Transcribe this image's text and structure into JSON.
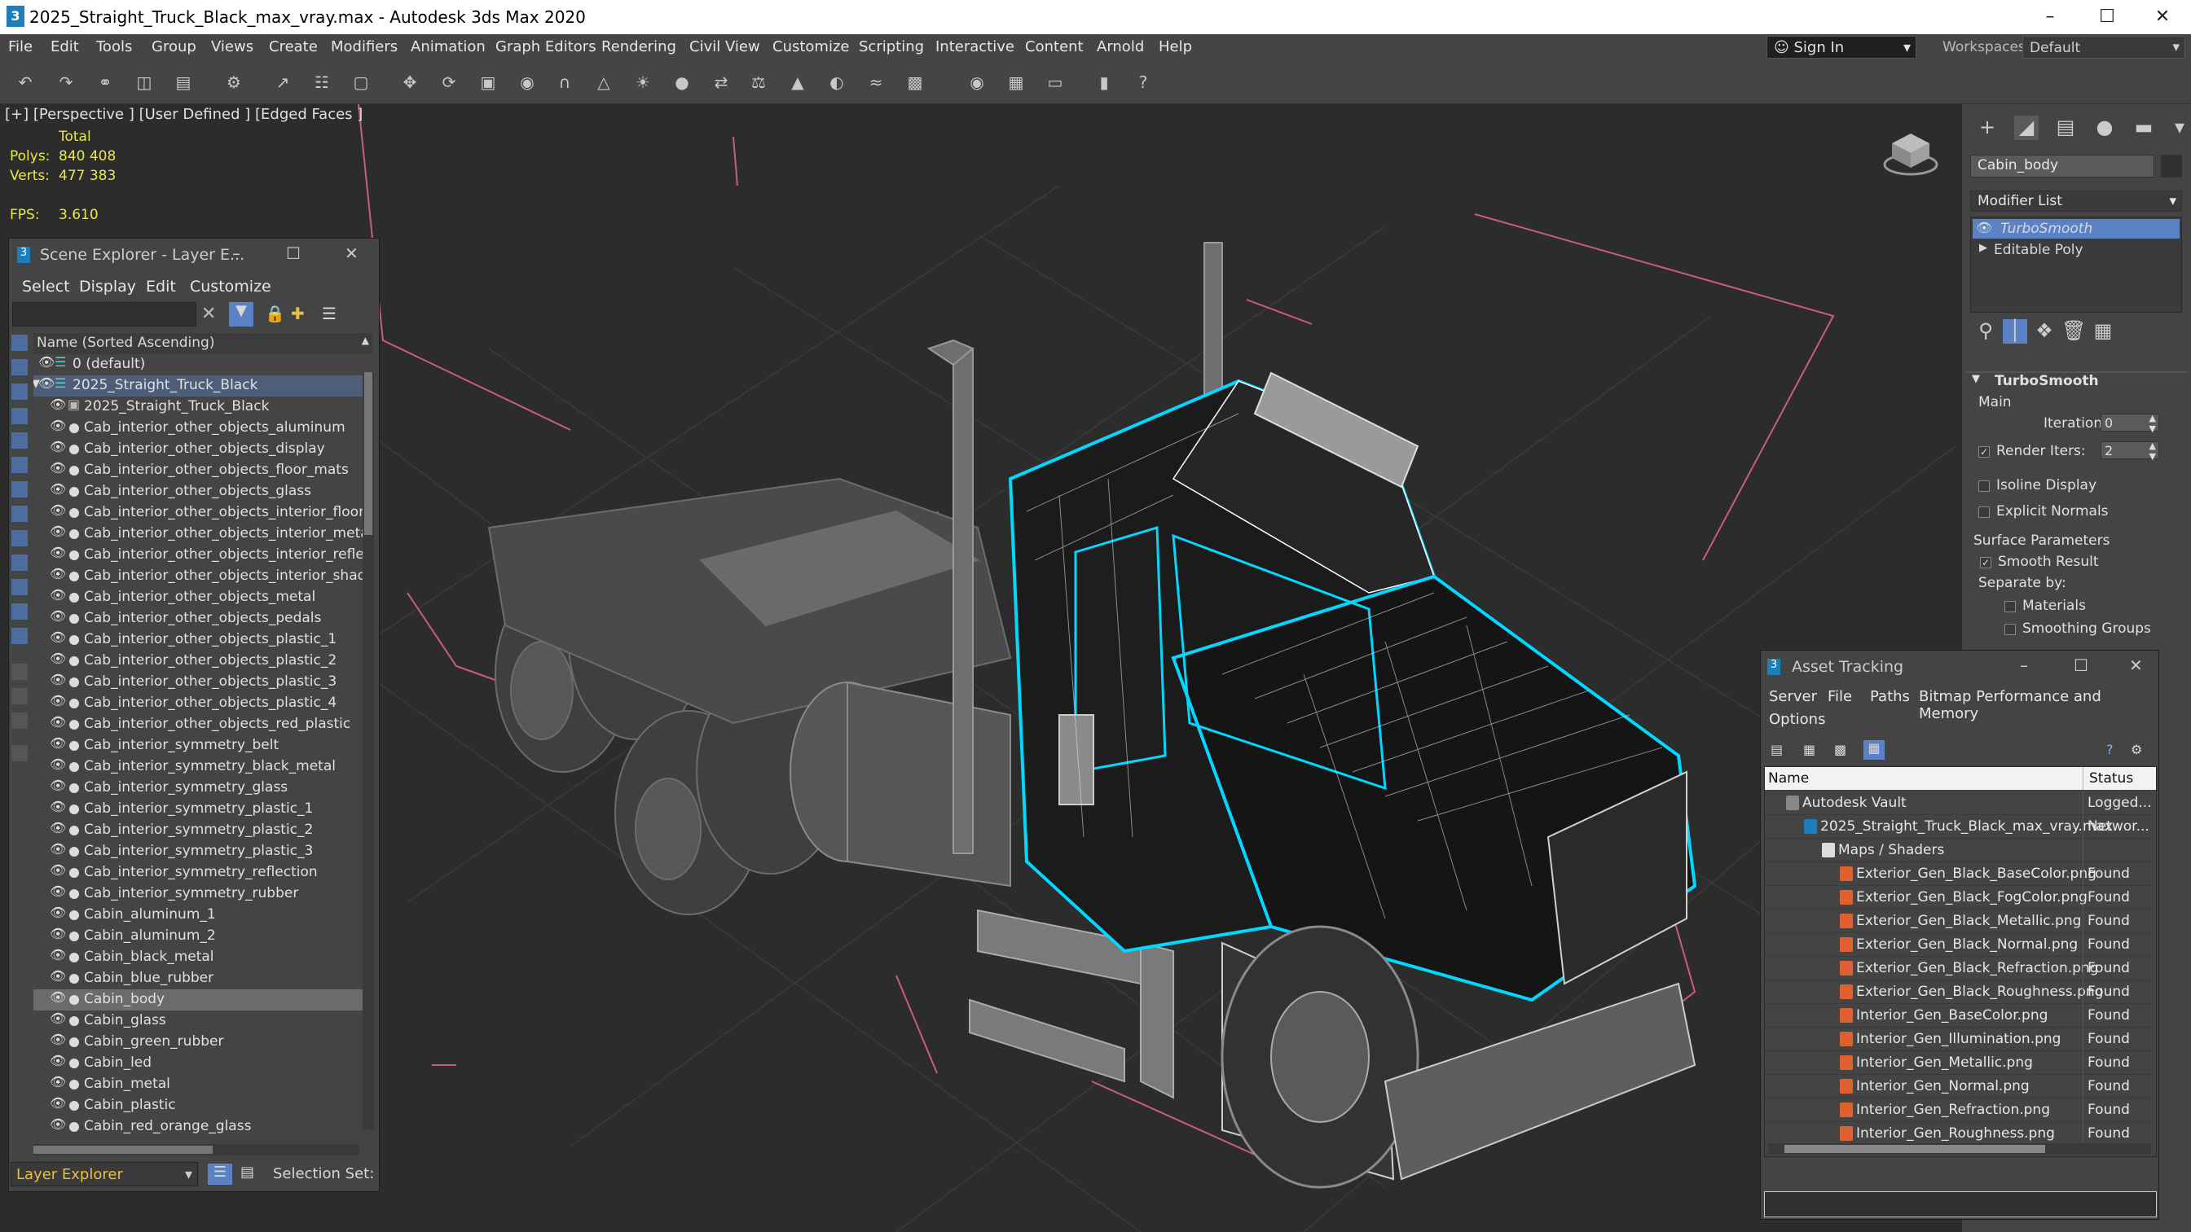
{
  "window": {
    "title": "2025_Straight_Truck_Black_max_vray.max - Autodesk 3ds Max 2020",
    "app_icon": "3"
  },
  "menu": [
    "File",
    "Edit",
    "Tools",
    "Group",
    "Views",
    "Create",
    "Modifiers",
    "Animation",
    "Graph Editors",
    "Rendering",
    "Civil View",
    "Customize",
    "Scripting",
    "Interactive",
    "Content",
    "Arnold",
    "Help"
  ],
  "signin": {
    "label": "Sign In"
  },
  "workspaces": {
    "label": "Workspaces:",
    "value": "Default"
  },
  "viewport": {
    "label": "[+] [Perspective ] [User Defined ] [Edged Faces ]",
    "stats": {
      "total_label": "Total",
      "polys_label": "Polys:",
      "polys": "840 408",
      "verts_label": "Verts:",
      "verts": "477 383",
      "fps_label": "FPS:",
      "fps": "3.610"
    }
  },
  "scene_explorer": {
    "title": "Scene Explorer - Layer E...",
    "menu": [
      "Select",
      "Display",
      "Edit",
      "Customize"
    ],
    "column_header": "Name (Sorted Ascending)",
    "layers": [
      {
        "name": "0 (default)",
        "kind": "layer",
        "indent": 0
      },
      {
        "name": "2025_Straight_Truck_Black",
        "kind": "layer",
        "indent": 0,
        "selected": true
      },
      {
        "name": "2025_Straight_Truck_Black",
        "kind": "group",
        "indent": 1
      },
      {
        "name": "Cab_interior_other_objects_aluminum",
        "kind": "obj",
        "indent": 1
      },
      {
        "name": "Cab_interior_other_objects_display",
        "kind": "obj",
        "indent": 1
      },
      {
        "name": "Cab_interior_other_objects_floor_mats",
        "kind": "obj",
        "indent": 1
      },
      {
        "name": "Cab_interior_other_objects_glass",
        "kind": "obj",
        "indent": 1
      },
      {
        "name": "Cab_interior_other_objects_interior_floor",
        "kind": "obj",
        "indent": 1
      },
      {
        "name": "Cab_interior_other_objects_interior_metal",
        "kind": "obj",
        "indent": 1
      },
      {
        "name": "Cab_interior_other_objects_interior_reflectio",
        "kind": "obj",
        "indent": 1
      },
      {
        "name": "Cab_interior_other_objects_interior_shadow",
        "kind": "obj",
        "indent": 1
      },
      {
        "name": "Cab_interior_other_objects_metal",
        "kind": "obj",
        "indent": 1
      },
      {
        "name": "Cab_interior_other_objects_pedals",
        "kind": "obj",
        "indent": 1
      },
      {
        "name": "Cab_interior_other_objects_plastic_1",
        "kind": "obj",
        "indent": 1
      },
      {
        "name": "Cab_interior_other_objects_plastic_2",
        "kind": "obj",
        "indent": 1
      },
      {
        "name": "Cab_interior_other_objects_plastic_3",
        "kind": "obj",
        "indent": 1
      },
      {
        "name": "Cab_interior_other_objects_plastic_4",
        "kind": "obj",
        "indent": 1
      },
      {
        "name": "Cab_interior_other_objects_red_plastic",
        "kind": "obj",
        "indent": 1
      },
      {
        "name": "Cab_interior_symmetry_belt",
        "kind": "obj",
        "indent": 1
      },
      {
        "name": "Cab_interior_symmetry_black_metal",
        "kind": "obj",
        "indent": 1
      },
      {
        "name": "Cab_interior_symmetry_glass",
        "kind": "obj",
        "indent": 1
      },
      {
        "name": "Cab_interior_symmetry_plastic_1",
        "kind": "obj",
        "indent": 1
      },
      {
        "name": "Cab_interior_symmetry_plastic_2",
        "kind": "obj",
        "indent": 1
      },
      {
        "name": "Cab_interior_symmetry_plastic_3",
        "kind": "obj",
        "indent": 1
      },
      {
        "name": "Cab_interior_symmetry_reflection",
        "kind": "obj",
        "indent": 1
      },
      {
        "name": "Cab_interior_symmetry_rubber",
        "kind": "obj",
        "indent": 1
      },
      {
        "name": "Cabin_aluminum_1",
        "kind": "obj",
        "indent": 1
      },
      {
        "name": "Cabin_aluminum_2",
        "kind": "obj",
        "indent": 1
      },
      {
        "name": "Cabin_black_metal",
        "kind": "obj",
        "indent": 1
      },
      {
        "name": "Cabin_blue_rubber",
        "kind": "obj",
        "indent": 1
      },
      {
        "name": "Cabin_body",
        "kind": "obj",
        "indent": 1,
        "highlight": true
      },
      {
        "name": "Cabin_glass",
        "kind": "obj",
        "indent": 1
      },
      {
        "name": "Cabin_green_rubber",
        "kind": "obj",
        "indent": 1
      },
      {
        "name": "Cabin_led",
        "kind": "obj",
        "indent": 1
      },
      {
        "name": "Cabin_metal",
        "kind": "obj",
        "indent": 1
      },
      {
        "name": "Cabin_plastic",
        "kind": "obj",
        "indent": 1
      },
      {
        "name": "Cabin_red_orange_glass",
        "kind": "obj",
        "indent": 1
      }
    ],
    "footer_mode": "Layer Explorer",
    "selection_set": "Selection Set:"
  },
  "command_panel": {
    "object_name": "Cabin_body",
    "modifier_list": "Modifier List",
    "stack": [
      "TurboSmooth",
      "Editable Poly"
    ],
    "rollout": "TurboSmooth",
    "main_label": "Main",
    "iterations_label": "Iterations:",
    "iterations": "0",
    "render_iters_label": "Render Iters:",
    "render_iters": "2",
    "isoline": "Isoline Display",
    "explicit_normals": "Explicit Normals",
    "surface_params": "Surface Parameters",
    "smooth_result": "Smooth Result",
    "separate_by": "Separate by:",
    "materials": "Materials",
    "smoothing_groups": "Smoothing Groups"
  },
  "asset_tracking": {
    "title": "Asset Tracking",
    "menu": [
      "Server",
      "File",
      "Paths",
      "Bitmap Performance and Memory"
    ],
    "menu2": "Options",
    "col_name": "Name",
    "col_status": "Status",
    "rows": [
      {
        "name": "Autodesk Vault",
        "status": "Logged...",
        "indent": 0,
        "icon": "vault"
      },
      {
        "name": "2025_Straight_Truck_Black_max_vray.max",
        "status": "Networ...",
        "indent": 1,
        "icon": "max"
      },
      {
        "name": "Maps / Shaders",
        "status": "",
        "indent": 2,
        "icon": "folder"
      },
      {
        "name": "Exterior_Gen_Black_BaseColor.png",
        "status": "Found",
        "indent": 3,
        "icon": "png"
      },
      {
        "name": "Exterior_Gen_Black_FogColor.png",
        "status": "Found",
        "indent": 3,
        "icon": "png"
      },
      {
        "name": "Exterior_Gen_Black_Metallic.png",
        "status": "Found",
        "indent": 3,
        "icon": "png"
      },
      {
        "name": "Exterior_Gen_Black_Normal.png",
        "status": "Found",
        "indent": 3,
        "icon": "png"
      },
      {
        "name": "Exterior_Gen_Black_Refraction.png",
        "status": "Found",
        "indent": 3,
        "icon": "png"
      },
      {
        "name": "Exterior_Gen_Black_Roughness.png",
        "status": "Found",
        "indent": 3,
        "icon": "png"
      },
      {
        "name": "Interior_Gen_BaseColor.png",
        "status": "Found",
        "indent": 3,
        "icon": "png"
      },
      {
        "name": "Interior_Gen_Illumination.png",
        "status": "Found",
        "indent": 3,
        "icon": "png"
      },
      {
        "name": "Interior_Gen_Metallic.png",
        "status": "Found",
        "indent": 3,
        "icon": "png"
      },
      {
        "name": "Interior_Gen_Normal.png",
        "status": "Found",
        "indent": 3,
        "icon": "png"
      },
      {
        "name": "Interior_Gen_Refraction.png",
        "status": "Found",
        "indent": 3,
        "icon": "png"
      },
      {
        "name": "Interior_Gen_Roughness.png",
        "status": "Found",
        "indent": 3,
        "icon": "png"
      }
    ]
  },
  "colors": {
    "selection": "#00d8ff",
    "stat_text": "#e8e84a",
    "highlight_row": "#5a6a8a",
    "stack_active": "#5b82c4"
  }
}
